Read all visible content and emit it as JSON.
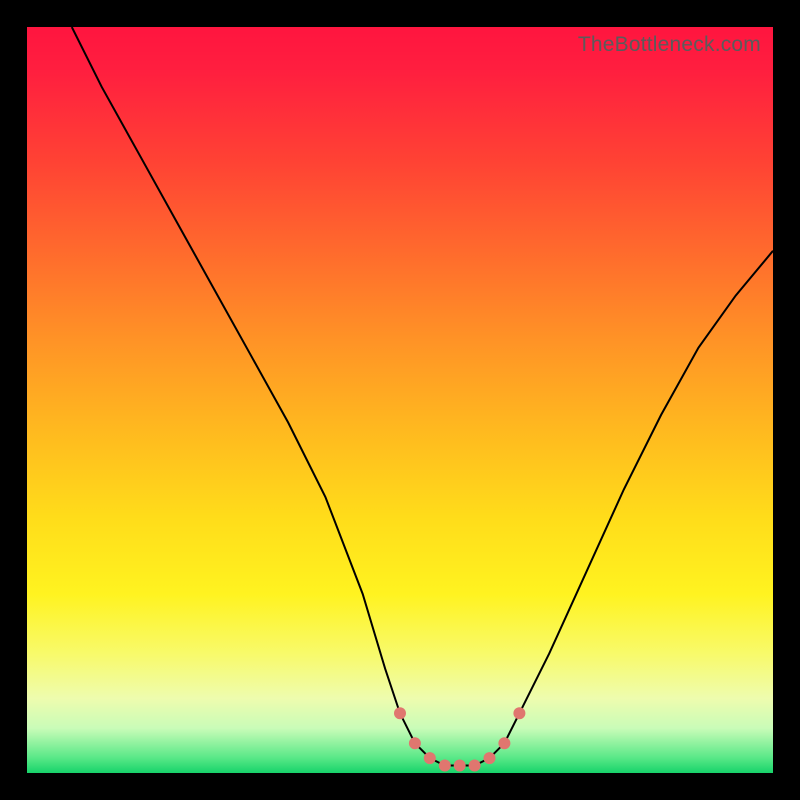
{
  "watermark": {
    "text": "TheBottleneck.com"
  },
  "colors": {
    "frame": "#000000",
    "curve": "#000000",
    "marker": "#e0766f"
  },
  "chart_data": {
    "type": "line",
    "title": "",
    "xlabel": "",
    "ylabel": "",
    "xlim": [
      0,
      100
    ],
    "ylim": [
      0,
      100
    ],
    "grid": false,
    "series": [
      {
        "name": "bottleneck-curve",
        "x": [
          6,
          10,
          15,
          20,
          25,
          30,
          35,
          40,
          45,
          48,
          50,
          52,
          54,
          56,
          58,
          60,
          62,
          64,
          66,
          70,
          75,
          80,
          85,
          90,
          95,
          100
        ],
        "y": [
          100,
          92,
          83,
          74,
          65,
          56,
          47,
          37,
          24,
          14,
          8,
          4,
          2,
          1,
          1,
          1,
          2,
          4,
          8,
          16,
          27,
          38,
          48,
          57,
          64,
          70
        ]
      }
    ],
    "markers": {
      "name": "valley-dots",
      "x": [
        50,
        52,
        54,
        56,
        58,
        60,
        62,
        64,
        66
      ],
      "y": [
        8,
        4,
        2,
        1,
        1,
        1,
        2,
        4,
        8
      ]
    },
    "legend": false
  }
}
